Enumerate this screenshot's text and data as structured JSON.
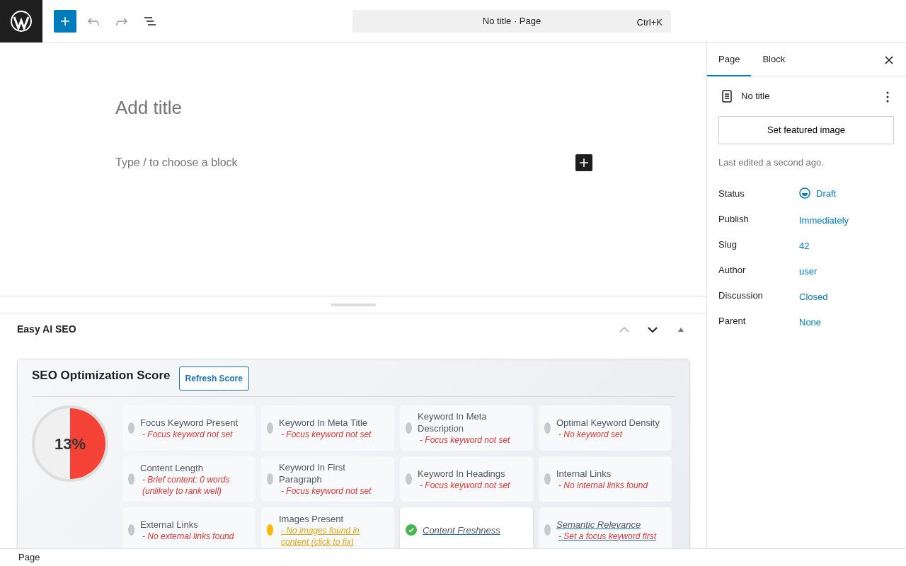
{
  "toolbar": {
    "command_bar": {
      "title": "No title · Page",
      "shortcut": "Ctrl+K"
    }
  },
  "editor": {
    "title_placeholder": "Add title",
    "block_placeholder": "Type / to choose a block"
  },
  "meta_box": {
    "title": "Easy AI SEO",
    "seo": {
      "title": "SEO Optimization Score",
      "refresh_button": "Refresh Score",
      "score": "13%",
      "checks": [
        {
          "label": "Focus Keyword Present",
          "detail": "- Focus keyword not set",
          "color": "#c9c9c9",
          "passed": false,
          "linked": false
        },
        {
          "label": "Keyword In Meta Title",
          "detail": "- Focus keyword not set",
          "color": "#c9c9c9",
          "passed": false,
          "linked": false
        },
        {
          "label": "Keyword In Meta Description",
          "detail": "- Focus keyword not set",
          "color": "#c9c9c9",
          "passed": false,
          "linked": false
        },
        {
          "label": "Optimal Keyword Density",
          "detail": "- No keyword set",
          "color": "#c9c9c9",
          "passed": false,
          "linked": false
        },
        {
          "label": "Content Length",
          "detail": "- Brief content: 0 words (unlikely to rank well)",
          "color": "#c9c9c9",
          "passed": false,
          "linked": false
        },
        {
          "label": "Keyword In First Paragraph",
          "detail": "- Focus keyword not set",
          "color": "#c9c9c9",
          "passed": false,
          "linked": false
        },
        {
          "label": "Keyword In Headings",
          "detail": "- Focus keyword not set",
          "color": "#c9c9c9",
          "passed": false,
          "linked": false
        },
        {
          "label": "Internal Links",
          "detail": "- No internal links found",
          "color": "#c9c9c9",
          "passed": false,
          "linked": false
        },
        {
          "label": "External Links",
          "detail": "- No external links found",
          "color": "#c9c9c9",
          "passed": false,
          "linked": false
        },
        {
          "label": "Images Present",
          "detail": "- No images found in content (click to fix)",
          "color": "#ffb900",
          "passed": false,
          "linked": false
        },
        {
          "label": "Content Freshness",
          "color": "#46b450",
          "passed": true,
          "linked": true
        },
        {
          "label": "Semantic Relevance",
          "detail": "- Set a focus keyword first",
          "color": "#c9c9c9",
          "passed": false,
          "linked": true
        }
      ]
    }
  },
  "sidebar": {
    "tabs": [
      {
        "label": "Page",
        "selected": true
      },
      {
        "label": "Block",
        "selected": false
      }
    ],
    "page_title": "No title",
    "featured_image_button": "Set featured image",
    "last_edited": "Last edited a second ago.",
    "fields": [
      {
        "label": "Status",
        "value": "Draft",
        "kind": "status"
      },
      {
        "label": "Publish",
        "value": "Immediately",
        "kind": "link"
      },
      {
        "label": "Slug",
        "value": "42",
        "kind": "link"
      },
      {
        "label": "Author",
        "value": "user",
        "kind": "link"
      },
      {
        "label": "Discussion",
        "value": "Closed",
        "kind": "link"
      },
      {
        "label": "Parent",
        "value": "None",
        "kind": "link"
      }
    ]
  },
  "footer": {
    "breadcrumb": "Page"
  }
}
